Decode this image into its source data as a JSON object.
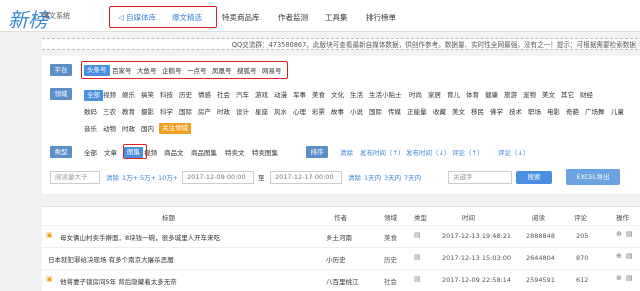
{
  "app": {
    "logo_mark": "新榜",
    "logo_text": "爆文系统"
  },
  "nav": [
    {
      "label": "◁ 自媒体库"
    },
    {
      "label": "爆文精选"
    },
    {
      "label": "特卖商品库"
    },
    {
      "label": "作者监测"
    },
    {
      "label": "工具集"
    },
    {
      "label": "排行榜单"
    }
  ],
  "notice": "QQ交流群：473580867。此版块可查看最新自媒体数据，供创作参考。数据量、实时性全网最强，没有之一！提示：可根据需要检索数据",
  "filters": {
    "platform_label": "平台",
    "platforms": [
      "头条号",
      "百家号",
      "大鱼号",
      "企鹅号",
      "一点号",
      "凤凰号",
      "搜狐号",
      "网易号"
    ],
    "domain_label": "领域",
    "domain_row1": [
      "全部",
      "视频",
      "娱乐",
      "搞笑",
      "科技",
      "历史",
      "情感",
      "社会",
      "汽车",
      "游戏",
      "动漫",
      "军事",
      "美食",
      "文化",
      "生活",
      "生活小贴士",
      "时尚",
      "家居",
      "育儿",
      "体育",
      "健康",
      "旅游",
      "宠物",
      "美文",
      "其它",
      "财经"
    ],
    "domain_row2": [
      "数码",
      "三农",
      "教育",
      "摄影",
      "科学",
      "国际",
      "房产",
      "时政",
      "设计",
      "星座",
      "风水",
      "心理",
      "彩票",
      "故事",
      "小说",
      "国际",
      "传媒",
      "正能量",
      "收藏",
      "美文",
      "移民",
      "佛学",
      "技术",
      "职场",
      "电影",
      "奇葩",
      "广场舞",
      "儿童"
    ],
    "domain_row3": [
      "音乐",
      "动物",
      "时政",
      "国内"
    ],
    "follow_label": "关注领域",
    "type_label": "类型",
    "types": [
      "全部",
      "文章",
      "图集",
      "视频",
      "商品文",
      "商品图集",
      "特卖文",
      "特卖图集"
    ],
    "sort_label": "排序",
    "sort_options": [
      "清除",
      "发布时间（↑）",
      "发布时间（↓）",
      "评论（↑）",
      "评论（↓）"
    ],
    "read_placeholder": "阅读量大于",
    "read_options": [
      "清除",
      "1万+",
      "5万+",
      "10万+"
    ],
    "date_from": "2017-12-09 00:00",
    "date_to_label": "至",
    "date_to": "2017-12-17 00:00",
    "date_options": [
      "清除",
      "1天内",
      "3天内",
      "7天内"
    ],
    "keyword_placeholder": "关键字",
    "search_button": "搜索",
    "export_button": "EXCEL导出"
  },
  "table": {
    "headers": [
      "标题",
      "作者",
      "领域",
      "类型",
      "时间",
      "阅读",
      "评论",
      "操作"
    ],
    "rows": [
      {
        "title": "母女俩山村卖手擀面，8块钱一碗，很多城里人开车来吃",
        "author": "乡土河南",
        "domain": "美食",
        "time": "2017-12-13 19:48:21",
        "reads": "2888848",
        "comments": "205"
      },
      {
        "title": "日本就犯罪给决现场 有多个南京大屠杀恶魔",
        "author": "小历史",
        "domain": "历史",
        "time": "2017-12-13 15:03:00",
        "reads": "2644804",
        "comments": "870"
      },
      {
        "title": "他将妻子锁房间5年 背后隐藏着太多无奈",
        "author": "八百里桃江",
        "domain": "社会",
        "time": "2017-12-09 22:58:14",
        "reads": "2594591",
        "comments": "612"
      }
    ]
  },
  "colors": {
    "accent": "#3a86d6",
    "label_bg": "#5b8fc7",
    "highlight": "#e02020",
    "orange": "#f0a020"
  }
}
